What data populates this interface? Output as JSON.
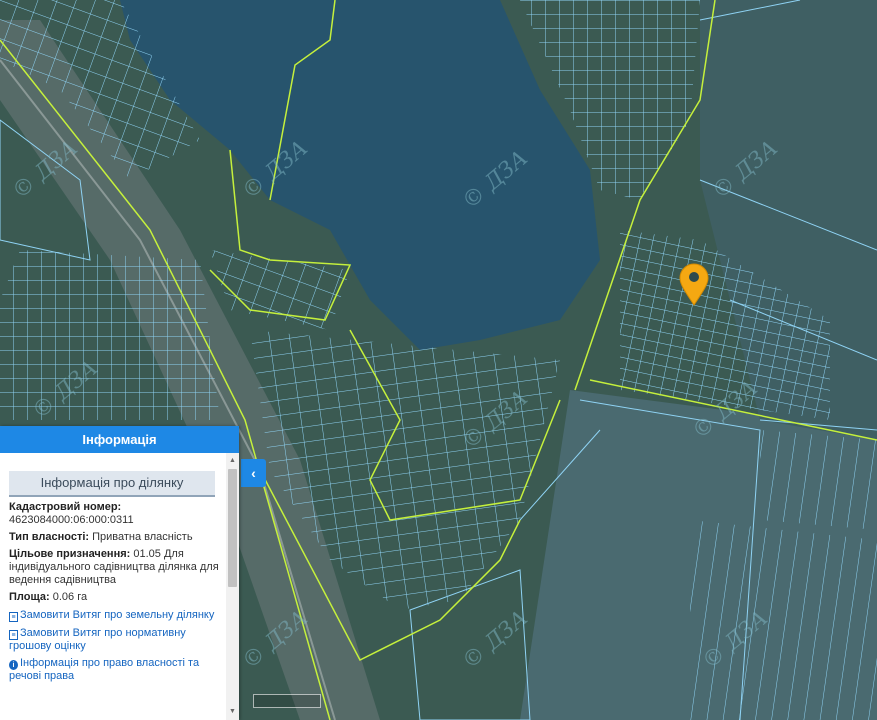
{
  "map": {
    "watermark": "© ДЗА",
    "marker_icon": "location-pin-icon",
    "colors": {
      "parcel_line": "#8fd3f4",
      "boundary_line": "#c5f03c",
      "water": "#27546d",
      "marker": "#f5a812",
      "panel_header": "#1e88e5"
    }
  },
  "panel": {
    "header": "Інформація",
    "section_title": "Інформація про ділянку",
    "cadastral_label": "Кадастровий номер:",
    "cadastral_value": "4623084000:06:000:0311",
    "ownership_label": "Тип власності:",
    "ownership_value": "Приватна власність",
    "purpose_label": "Цільове призначення:",
    "purpose_value": "01.05 Для індивідуального садівництва ділянка для ведення садівництва",
    "area_label": "Площа:",
    "area_value": "0.06 га",
    "links": [
      {
        "icon": "document-icon",
        "label": "Замовити Витяг про земельну ділянку"
      },
      {
        "icon": "document-icon",
        "label": "Замовити Витяг про нормативну грошову оцінку"
      },
      {
        "icon": "info-icon",
        "label": "Інформація про право власності та речові права"
      }
    ]
  },
  "controls": {
    "collapse_icon": "chevron-left-icon"
  }
}
